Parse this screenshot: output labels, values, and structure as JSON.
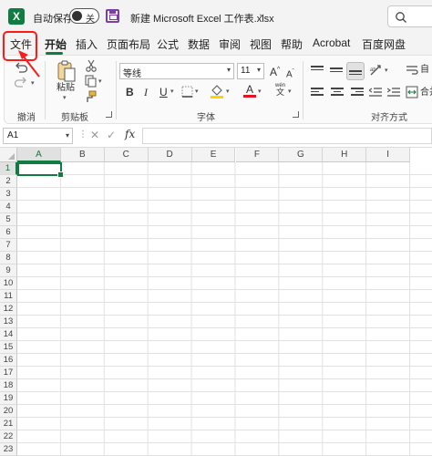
{
  "titlebar": {
    "app_icon": "excel-logo-icon",
    "app_icon_letter": "X",
    "autosave_label": "自动保存",
    "autosave_state": "关",
    "document_title": "新建 Microsoft Excel 工作表.xlsx",
    "title_chevron": "⌄"
  },
  "tabs": {
    "items": [
      "文件",
      "开始",
      "插入",
      "页面布局",
      "公式",
      "数据",
      "审阅",
      "视图",
      "帮助",
      "Acrobat",
      "百度网盘"
    ],
    "active": "开始"
  },
  "ribbon": {
    "groups": {
      "undo": "撤消",
      "clipboard": "剪贴板",
      "font": "字体",
      "alignment": "对齐方式"
    },
    "paste_label": "粘贴",
    "font_name": "等线",
    "font_size": "11",
    "bold": "B",
    "italic": "I",
    "underline": "U",
    "grow_font": "A",
    "shrink_font": "A",
    "font_color_letter": "A",
    "phonetic": "wén",
    "phonetic_char": "文",
    "merge_label": "合并",
    "wrap_label": "自",
    "font_color": "#e81123",
    "fill_color": "#ffd400"
  },
  "formula_bar": {
    "name_box": "A1",
    "formula": ""
  },
  "grid": {
    "columns": [
      "A",
      "B",
      "C",
      "D",
      "E",
      "F",
      "G",
      "H",
      "I"
    ],
    "rows": [
      "1",
      "2",
      "3",
      "4",
      "5",
      "6",
      "7",
      "8",
      "9",
      "10",
      "11",
      "12",
      "13",
      "14",
      "15",
      "16",
      "17",
      "18",
      "19",
      "20",
      "21",
      "22",
      "23"
    ],
    "active_cell": "A1"
  },
  "annotation": {
    "highlight_color": "#ff1a1a",
    "target": "tab-file"
  }
}
